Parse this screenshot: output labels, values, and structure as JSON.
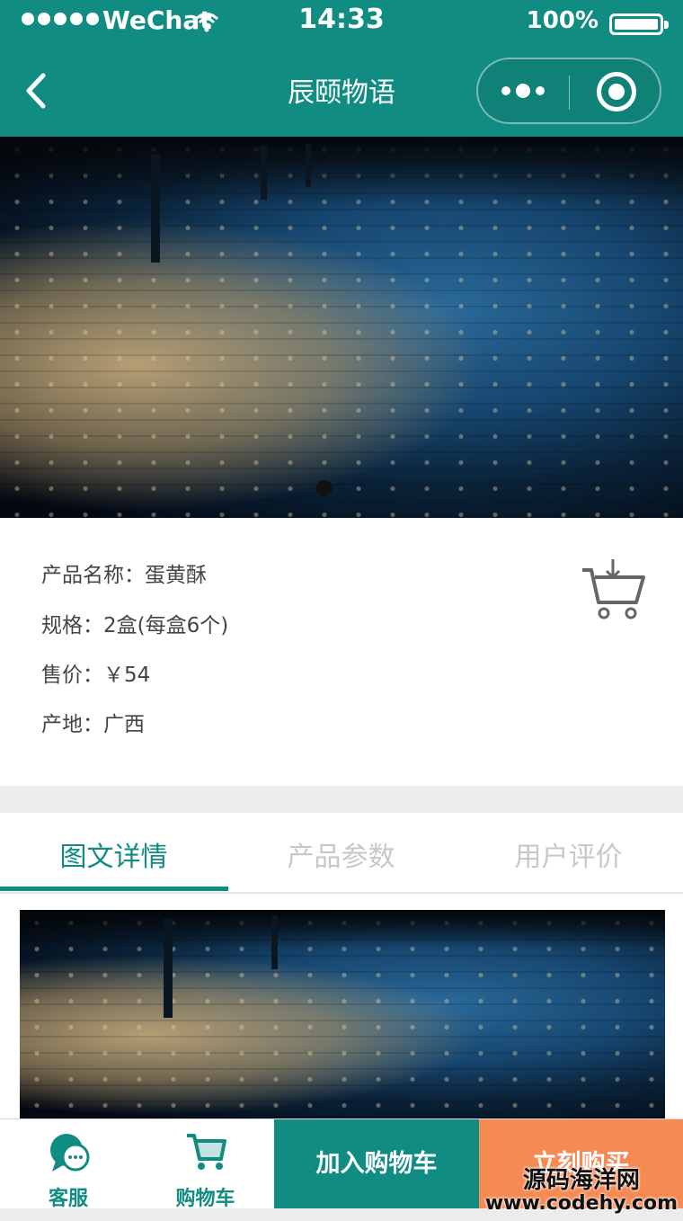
{
  "status_bar": {
    "carrier": "WeChat",
    "time": "14:33",
    "battery": "100%"
  },
  "nav": {
    "title": "辰颐物语"
  },
  "hero": {
    "slide_count": 1,
    "current_slide": 1
  },
  "product": {
    "name_row": "产品名称：蛋黄酥",
    "spec_row": "规格：2盒(每盒6个)",
    "price_row": "售价：￥54",
    "origin_row": "产地：广西"
  },
  "tabs": [
    {
      "label": "图文详情",
      "active": true
    },
    {
      "label": "产品参数",
      "active": false
    },
    {
      "label": "用户评价",
      "active": false
    }
  ],
  "bottom_bar": {
    "service_label": "客服",
    "cart_label": "购物车",
    "add_to_cart": "加入购物车",
    "buy_now": "立刻购买"
  },
  "watermark": {
    "line1": "源码海洋网",
    "line2": "www.codehy.com"
  },
  "colors": {
    "primary": "#118c82",
    "buy": "#f58a52"
  },
  "icons": {
    "back": "chevron-left-icon",
    "more": "more-dots-icon",
    "close": "target-circle-icon",
    "add_cart": "cart-download-icon",
    "service": "chat-bubble-icon",
    "cart": "cart-icon"
  }
}
